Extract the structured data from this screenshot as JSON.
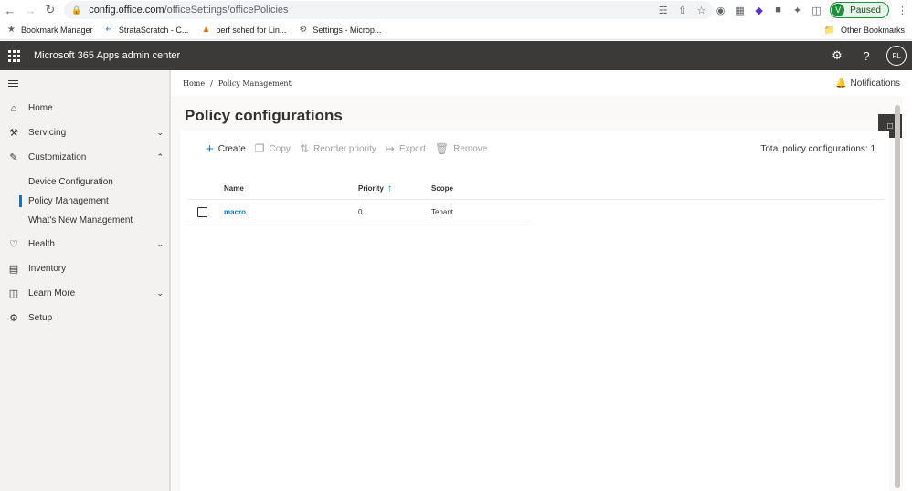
{
  "browser": {
    "url_host": "config.office.com",
    "url_path": "/officeSettings/officePolicies",
    "profile_initial": "V",
    "profile_status": "Paused",
    "bookmarks": [
      {
        "label": "Bookmark Manager",
        "icon": "star-icon"
      },
      {
        "label": "StrataScratch - C...",
        "icon": "strata-icon"
      },
      {
        "label": "perf sched for Lin...",
        "icon": "flame-icon"
      },
      {
        "label": "Settings - Microp...",
        "icon": "gear-icon"
      }
    ],
    "other_bookmarks": "Other Bookmarks"
  },
  "header": {
    "title": "Microsoft 365 Apps admin center",
    "avatar": "FL"
  },
  "sidebar": {
    "items": [
      {
        "label": "Home",
        "icon": "home-icon"
      },
      {
        "label": "Servicing",
        "icon": "servicing-icon"
      },
      {
        "label": "Customization",
        "icon": "customization-icon"
      },
      {
        "label": "Device Configuration"
      },
      {
        "label": "Policy Management"
      },
      {
        "label": "What's New Management"
      },
      {
        "label": "Health",
        "icon": "heart-icon"
      },
      {
        "label": "Inventory",
        "icon": "inventory-icon"
      },
      {
        "label": "Learn More",
        "icon": "book-icon"
      },
      {
        "label": "Setup",
        "icon": "gear-icon"
      }
    ]
  },
  "breadcrumb": {
    "home": "Home",
    "separator": "/",
    "current": "Policy Management"
  },
  "notifications": "Notifications",
  "page": {
    "title": "Policy configurations"
  },
  "toolbar": {
    "create": "Create",
    "copy": "Copy",
    "reorder": "Reorder priority",
    "export": "Export",
    "remove": "Remove",
    "total": "Total policy configurations: 1"
  },
  "table": {
    "columns": [
      "Name",
      "Priority",
      "Scope"
    ],
    "rows": [
      {
        "name": "macro",
        "priority": "0",
        "scope": "Tenant"
      }
    ]
  },
  "colors": {
    "accent": "#0078d4",
    "header_bg": "#3b3a39",
    "sidebar_bg": "#f3f2f1"
  }
}
